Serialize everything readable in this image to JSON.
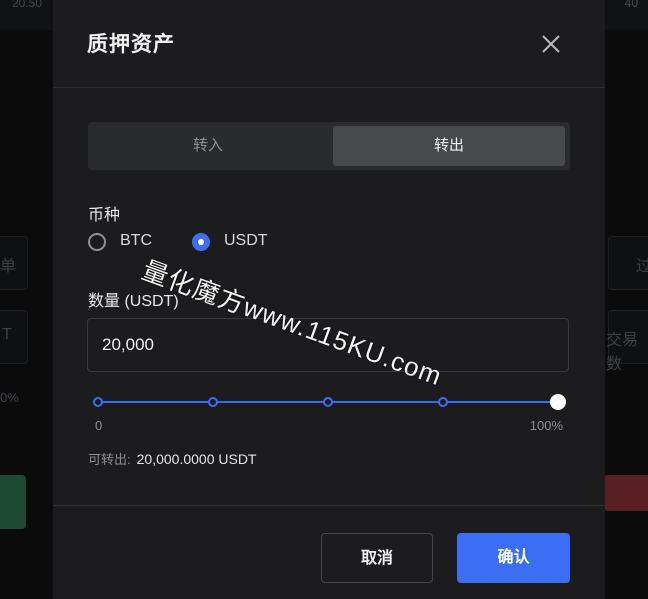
{
  "background": {
    "top_left": "20.50",
    "top_right": "40",
    "left_fragments": [
      "单",
      "T",
      "0%"
    ],
    "right_fragments": [
      "过",
      "交易数"
    ]
  },
  "dialog": {
    "title": "质押资产",
    "tabs": [
      {
        "label": "转入",
        "active": false
      },
      {
        "label": "转出",
        "active": true
      }
    ],
    "coin_label": "币种",
    "coins": [
      {
        "label": "BTC",
        "selected": false
      },
      {
        "label": "USDT",
        "selected": true
      }
    ],
    "quantity_label": "数量 (USDT)",
    "quantity_value": "20,000",
    "slider": {
      "min_label": "0",
      "max_label": "100%",
      "value_percent": 100
    },
    "available_label": "可转出:",
    "available_value": "20,000.0000 USDT",
    "cancel_label": "取消",
    "confirm_label": "确认"
  },
  "colors": {
    "accent": "#3b6ef5",
    "dialog_bg": "#1c1c1e"
  },
  "watermark": "量化魔方www.115KU.com"
}
